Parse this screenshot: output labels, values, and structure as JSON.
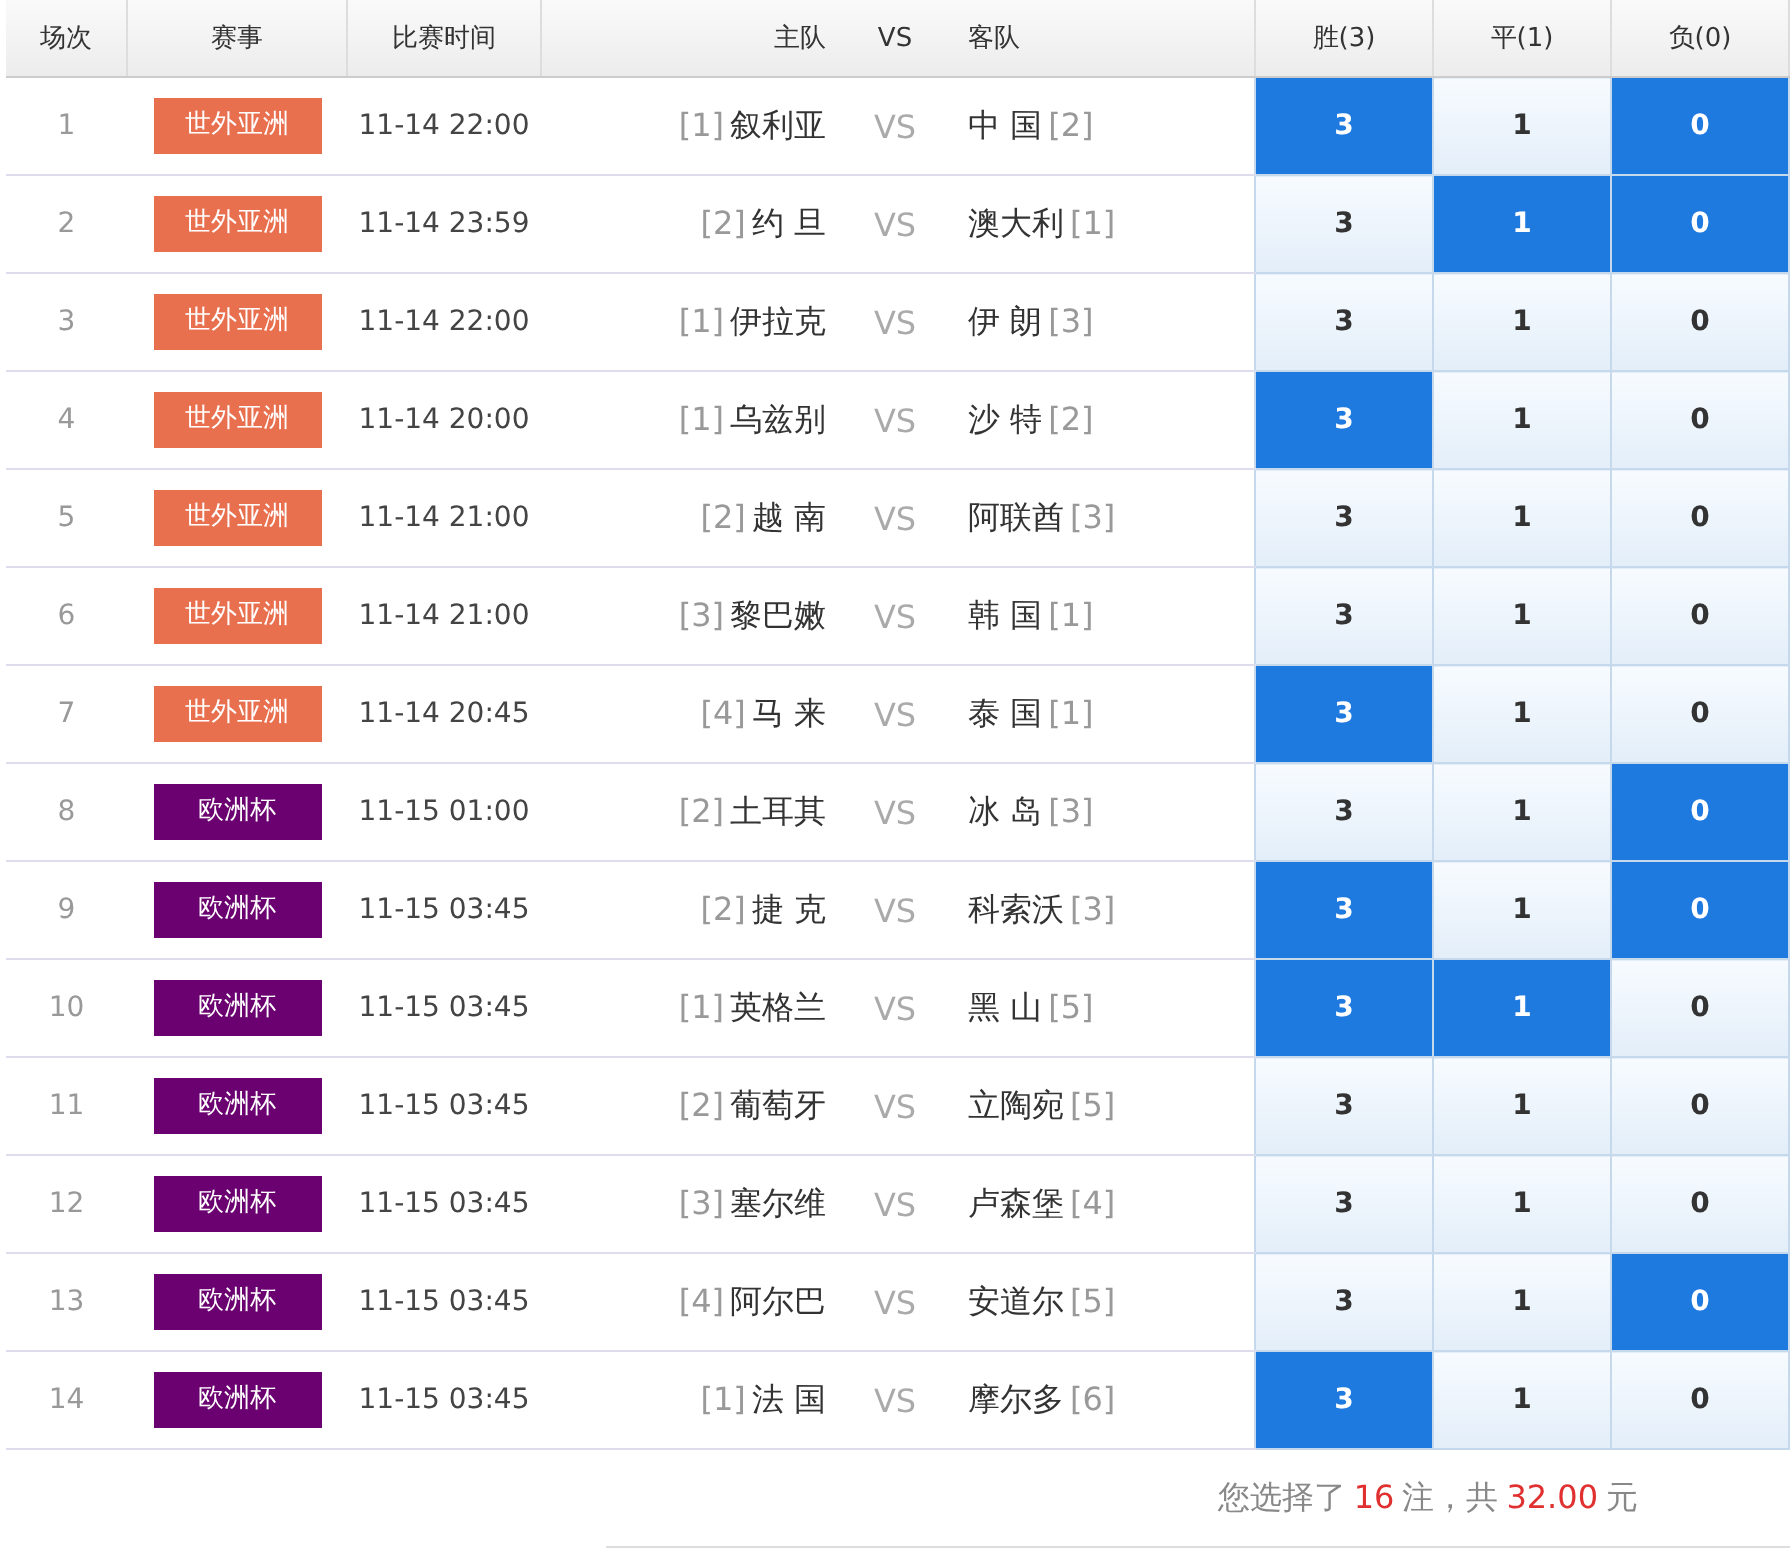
{
  "columns": [
    "场次",
    "赛事",
    "比赛时间",
    "主队",
    "VS",
    "客队",
    "胜(3)",
    "平(1)",
    "负(0)"
  ],
  "rows": [
    {
      "no": "1",
      "league": "世外亚洲",
      "color": "#e8704f",
      "time": "11-14 22:00",
      "home_rank": "[1]",
      "home": "叙利亚",
      "vs": "VS",
      "away": "中 国",
      "away_rank": "[2]",
      "odds": [
        {
          "label": "3",
          "selected": true
        },
        {
          "label": "1",
          "selected": false
        },
        {
          "label": "0",
          "selected": true
        }
      ]
    },
    {
      "no": "2",
      "league": "世外亚洲",
      "color": "#e8704f",
      "time": "11-14 23:59",
      "home_rank": "[2]",
      "home": "约 旦",
      "vs": "VS",
      "away": "澳大利",
      "away_rank": "[1]",
      "odds": [
        {
          "label": "3",
          "selected": false
        },
        {
          "label": "1",
          "selected": true
        },
        {
          "label": "0",
          "selected": true
        }
      ]
    },
    {
      "no": "3",
      "league": "世外亚洲",
      "color": "#e8704f",
      "time": "11-14 22:00",
      "home_rank": "[1]",
      "home": "伊拉克",
      "vs": "VS",
      "away": "伊 朗",
      "away_rank": "[3]",
      "odds": [
        {
          "label": "3",
          "selected": false
        },
        {
          "label": "1",
          "selected": false
        },
        {
          "label": "0",
          "selected": false
        }
      ]
    },
    {
      "no": "4",
      "league": "世外亚洲",
      "color": "#e8704f",
      "time": "11-14 20:00",
      "home_rank": "[1]",
      "home": "乌兹别",
      "vs": "VS",
      "away": "沙 特",
      "away_rank": "[2]",
      "odds": [
        {
          "label": "3",
          "selected": true
        },
        {
          "label": "1",
          "selected": false
        },
        {
          "label": "0",
          "selected": false
        }
      ]
    },
    {
      "no": "5",
      "league": "世外亚洲",
      "color": "#e8704f",
      "time": "11-14 21:00",
      "home_rank": "[2]",
      "home": "越 南",
      "vs": "VS",
      "away": "阿联酋",
      "away_rank": "[3]",
      "odds": [
        {
          "label": "3",
          "selected": false
        },
        {
          "label": "1",
          "selected": false
        },
        {
          "label": "0",
          "selected": false
        }
      ]
    },
    {
      "no": "6",
      "league": "世外亚洲",
      "color": "#e8704f",
      "time": "11-14 21:00",
      "home_rank": "[3]",
      "home": "黎巴嫩",
      "vs": "VS",
      "away": "韩 国",
      "away_rank": "[1]",
      "odds": [
        {
          "label": "3",
          "selected": false
        },
        {
          "label": "1",
          "selected": false
        },
        {
          "label": "0",
          "selected": false
        }
      ]
    },
    {
      "no": "7",
      "league": "世外亚洲",
      "color": "#e8704f",
      "time": "11-14 20:45",
      "home_rank": "[4]",
      "home": "马 来",
      "vs": "VS",
      "away": "泰 国",
      "away_rank": "[1]",
      "odds": [
        {
          "label": "3",
          "selected": true
        },
        {
          "label": "1",
          "selected": false
        },
        {
          "label": "0",
          "selected": false
        }
      ]
    },
    {
      "no": "8",
      "league": "欧洲杯",
      "color": "#6b0070",
      "time": "11-15 01:00",
      "home_rank": "[2]",
      "home": "土耳其",
      "vs": "VS",
      "away": "冰 岛",
      "away_rank": "[3]",
      "odds": [
        {
          "label": "3",
          "selected": false
        },
        {
          "label": "1",
          "selected": false
        },
        {
          "label": "0",
          "selected": true
        }
      ]
    },
    {
      "no": "9",
      "league": "欧洲杯",
      "color": "#6b0070",
      "time": "11-15 03:45",
      "home_rank": "[2]",
      "home": "捷 克",
      "vs": "VS",
      "away": "科索沃",
      "away_rank": "[3]",
      "odds": [
        {
          "label": "3",
          "selected": true
        },
        {
          "label": "1",
          "selected": false
        },
        {
          "label": "0",
          "selected": true
        }
      ]
    },
    {
      "no": "10",
      "league": "欧洲杯",
      "color": "#6b0070",
      "time": "11-15 03:45",
      "home_rank": "[1]",
      "home": "英格兰",
      "vs": "VS",
      "away": "黑 山",
      "away_rank": "[5]",
      "odds": [
        {
          "label": "3",
          "selected": true
        },
        {
          "label": "1",
          "selected": true
        },
        {
          "label": "0",
          "selected": false
        }
      ]
    },
    {
      "no": "11",
      "league": "欧洲杯",
      "color": "#6b0070",
      "time": "11-15 03:45",
      "home_rank": "[2]",
      "home": "葡萄牙",
      "vs": "VS",
      "away": "立陶宛",
      "away_rank": "[5]",
      "odds": [
        {
          "label": "3",
          "selected": false
        },
        {
          "label": "1",
          "selected": false
        },
        {
          "label": "0",
          "selected": false
        }
      ]
    },
    {
      "no": "12",
      "league": "欧洲杯",
      "color": "#6b0070",
      "time": "11-15 03:45",
      "home_rank": "[3]",
      "home": "塞尔维",
      "vs": "VS",
      "away": "卢森堡",
      "away_rank": "[4]",
      "odds": [
        {
          "label": "3",
          "selected": false
        },
        {
          "label": "1",
          "selected": false
        },
        {
          "label": "0",
          "selected": false
        }
      ]
    },
    {
      "no": "13",
      "league": "欧洲杯",
      "color": "#6b0070",
      "time": "11-15 03:45",
      "home_rank": "[4]",
      "home": "阿尔巴",
      "vs": "VS",
      "away": "安道尔",
      "away_rank": "[5]",
      "odds": [
        {
          "label": "3",
          "selected": false
        },
        {
          "label": "1",
          "selected": false
        },
        {
          "label": "0",
          "selected": true
        }
      ]
    },
    {
      "no": "14",
      "league": "欧洲杯",
      "color": "#6b0070",
      "time": "11-15 03:45",
      "home_rank": "[1]",
      "home": "法 国",
      "vs": "VS",
      "away": "摩尔多",
      "away_rank": "[6]",
      "odds": [
        {
          "label": "3",
          "selected": true
        },
        {
          "label": "1",
          "selected": false
        },
        {
          "label": "0",
          "selected": false
        }
      ]
    }
  ],
  "summary": {
    "prefix": "您选择了",
    "count": "16",
    "middle": "注，共",
    "amount": "32.00",
    "suffix": "元"
  }
}
